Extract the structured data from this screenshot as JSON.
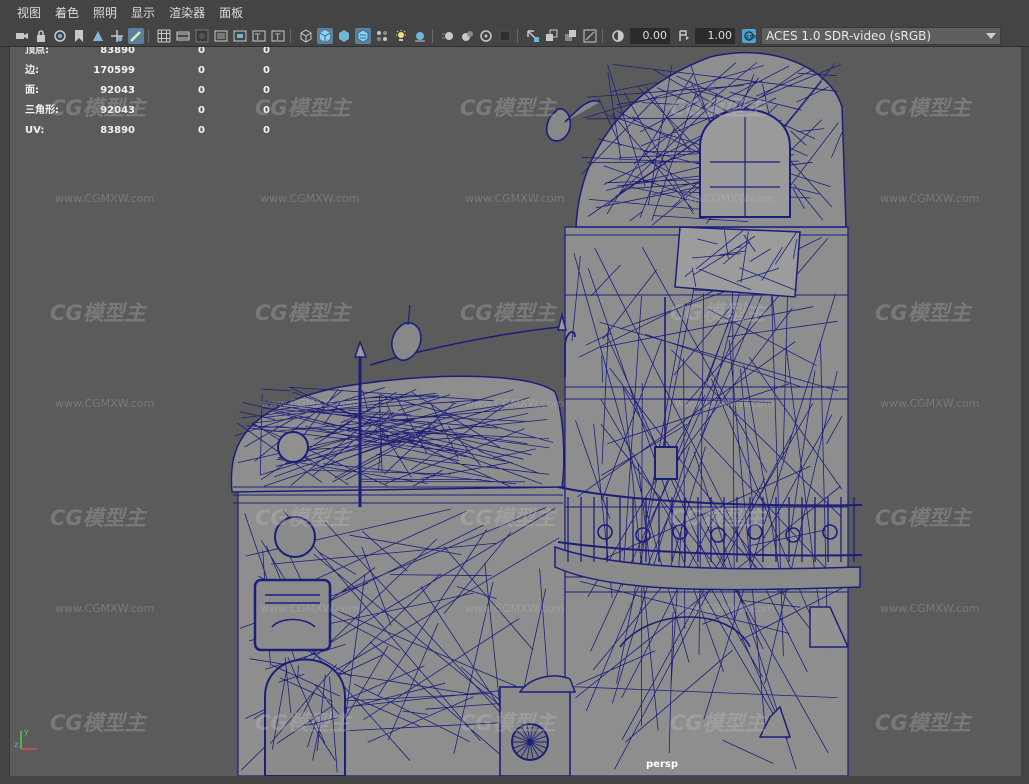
{
  "menubar": {
    "items": [
      "视图",
      "着色",
      "照明",
      "显示",
      "渲染器",
      "面板"
    ]
  },
  "toolbar": {
    "exposure_value": "0.00",
    "gamma_value": "1.00",
    "color_space": "ACES 1.0 SDR-video (sRGB)",
    "icons": [
      "select-camera-icon",
      "lock-camera-icon",
      "camera-attributes-icon",
      "bookmark-icon",
      "image-plane-icon",
      "2d-pan-zoom-icon",
      "grease-pencil-icon",
      "grid-icon",
      "film-gate-icon",
      "resolution-gate-icon",
      "gate-mask-icon",
      "field-chart-icon",
      "safe-action-icon",
      "safe-title-icon",
      "wireframe-icon",
      "smooth-shade-icon",
      "bounding-box-icon",
      "textured-icon",
      "use-all-lights-icon",
      "shadows-icon",
      "screen-space-ao-icon",
      "motion-blur-icon",
      "anti-aliasing-icon",
      "depth-of-field-icon",
      "isolate-select-icon",
      "xray-icon",
      "xray-joints-icon",
      "xray-active-icon",
      "backface-culling-icon",
      "exposure-icon",
      "gamma-icon",
      "color-management-icon"
    ]
  },
  "hud": {
    "rows": [
      {
        "label": "顶点:",
        "v1": "83890",
        "v2": "0",
        "v3": "0"
      },
      {
        "label": "边:",
        "v1": "170599",
        "v2": "0",
        "v3": "0"
      },
      {
        "label": "面:",
        "v1": "92043",
        "v2": "0",
        "v3": "0"
      },
      {
        "label": "三角形:",
        "v1": "92043",
        "v2": "0",
        "v3": "0"
      },
      {
        "label": "UV:",
        "v1": "83890",
        "v2": "0",
        "v3": "0"
      }
    ]
  },
  "viewport": {
    "camera_label": "persp",
    "axis_y": "y",
    "axis_z": "z",
    "wireframe_color": "#1c1f7a",
    "mesh_fill": "#8e8e8e",
    "background": "#5b5b5b"
  },
  "watermark": {
    "logo": "CG模型主",
    "url": "www.CGMXW.com"
  }
}
